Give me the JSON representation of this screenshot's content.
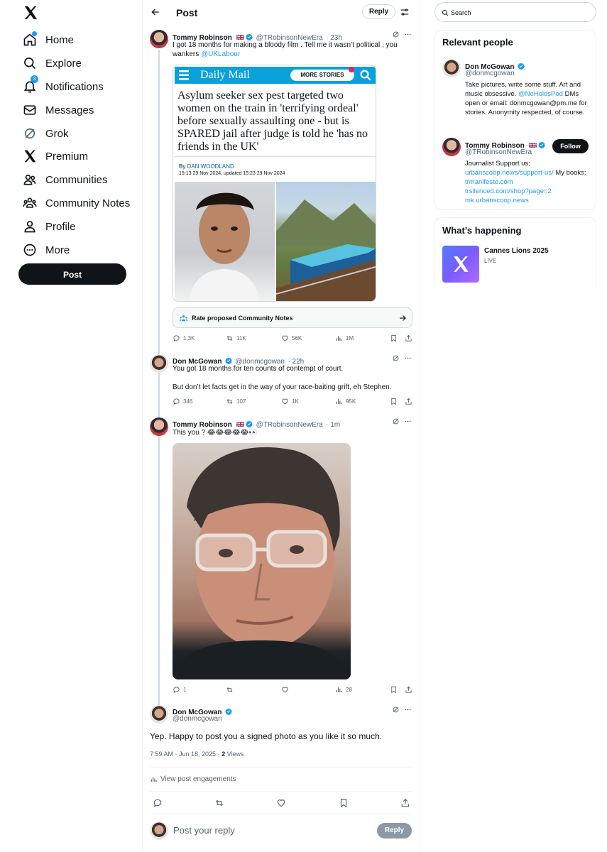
{
  "nav": {
    "items": [
      {
        "label": "Home",
        "icon": "home-icon"
      },
      {
        "label": "Explore",
        "icon": "search-icon"
      },
      {
        "label": "Notifications",
        "icon": "bell-icon",
        "badge": "3"
      },
      {
        "label": "Messages",
        "icon": "mail-icon"
      },
      {
        "label": "Grok",
        "icon": "grok-icon"
      },
      {
        "label": "Premium",
        "icon": "x-icon"
      },
      {
        "label": "Communities",
        "icon": "communities-icon"
      },
      {
        "label": "Community Notes",
        "icon": "community-notes-icon"
      },
      {
        "label": "Profile",
        "icon": "person-icon"
      },
      {
        "label": "More",
        "icon": "more-circle-icon"
      }
    ],
    "post_button": "Post"
  },
  "header": {
    "title": "Post",
    "reply_label": "Reply"
  },
  "tweets": [
    {
      "name": "Tommy Robinson",
      "flag": "🇬🇧",
      "handle": "@TRobinsonNewEra",
      "time": "· 23h",
      "text": "I got 18 months for making a bloody film . Tell me it wasn’t political , you wankers ",
      "mention": "@UKLabour",
      "card": {
        "brand": "Daily Mail",
        "more_stories": "MORE STORIES",
        "headline": "Asylum seeker sex pest targeted two women on the train in 'terrifying ordeal' before sexually assaulting one - but is SPARED jail after judge is told he 'has no friends in the UK'",
        "by_label": "By ",
        "author": "DAN WOODLAND",
        "date": "15:13 29 Nov 2024, updated 15:23 29 Nov 2024"
      },
      "community_notes": "Rate proposed Community Notes",
      "stats": {
        "replies": "1.3K",
        "reposts": "11K",
        "likes": "56K",
        "views": "1M"
      }
    },
    {
      "name": "Don McGowan",
      "handle": "@donmcgowan",
      "time": "· 22h",
      "text1": "You got 18 months for ten counts of contempt of court.",
      "text2": "But don’t let facts get in the way of your race-baiting grift, eh Stephen.",
      "stats": {
        "replies": "346",
        "reposts": "107",
        "likes": "1K",
        "views": "95K"
      }
    },
    {
      "name": "Tommy Robinson",
      "flag": "🇬🇧",
      "handle": "@TRobinsonNewEra",
      "time": "· 1m",
      "text": "This you ? 😂😂😂😂😂👀",
      "stats": {
        "replies": "1",
        "reposts": "",
        "likes": "",
        "views": "28"
      }
    }
  ],
  "focus": {
    "name": "Don McGowan",
    "handle": "@donmcgowan",
    "text": "Yep. Happy to post you a signed photo as you like it so much.",
    "time": "7:59 AM · Jun 18, 2025 · ",
    "views_count": "2",
    "views_label": " Views",
    "engagements": "View post engagements"
  },
  "reply_box": {
    "placeholder": "Post your reply",
    "button": "Reply"
  },
  "right": {
    "search_placeholder": "Search",
    "relevant_title": "Relevant people",
    "people": [
      {
        "name": "Don McGowan",
        "handle": "@donmcgowan",
        "bio1": "Take pictures, write some stuff. Art and music obsessive. ",
        "bio_mention": "@NoHoldsPod",
        "bio2": " DMs open or email: donmcgowan@pm.me for stories. Anonymity respected, of course."
      },
      {
        "name": "Tommy Robinson",
        "flag": "🇬🇧",
        "handle": "@TRobinsonNewEra",
        "follow": "Follow",
        "bio1": "Journalist Support us: ",
        "link1": "urbanscoop.news/support-us/",
        "bio2": " My books: ",
        "link2": "trmanifesto.com",
        "link3": "trsilenced.com/shop?page=2",
        "link4": "mk.urbanscoop.news"
      }
    ],
    "happening_title": "What’s happening",
    "trend": {
      "title": "Cannes Lions 2025",
      "status": "LIVE"
    }
  },
  "colors": {
    "accent": "#1d9bf0",
    "text": "#0f1419",
    "muted": "#536471",
    "border": "#cfd9de"
  }
}
